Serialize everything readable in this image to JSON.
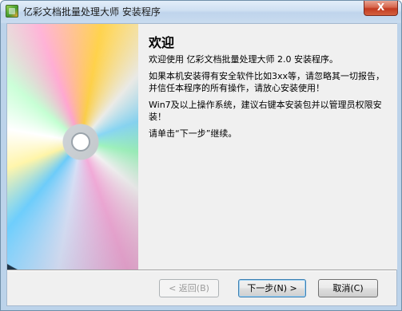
{
  "window": {
    "title": "亿彩文档批量处理大师 安装程序",
    "close_label": "X"
  },
  "content": {
    "heading": "欢迎",
    "paragraphs": [
      "欢迎使用 亿彩文档批量处理大师 2.0 安装程序。",
      "如果本机安装得有安全软件比如3xx等，请忽略其一切报告，并信任本程序的所有操作，请放心安装使用！",
      "Win7及以上操作系统，建议右键本安装包并以管理员权限安装！",
      "请单击“下一步”继续。"
    ]
  },
  "buttons": {
    "back": "< 返回(B)",
    "next": "下一步(N) >",
    "cancel": "取消(C)"
  },
  "icons": {
    "app": "installer-app-icon",
    "side_image": "cd-disc-image"
  }
}
